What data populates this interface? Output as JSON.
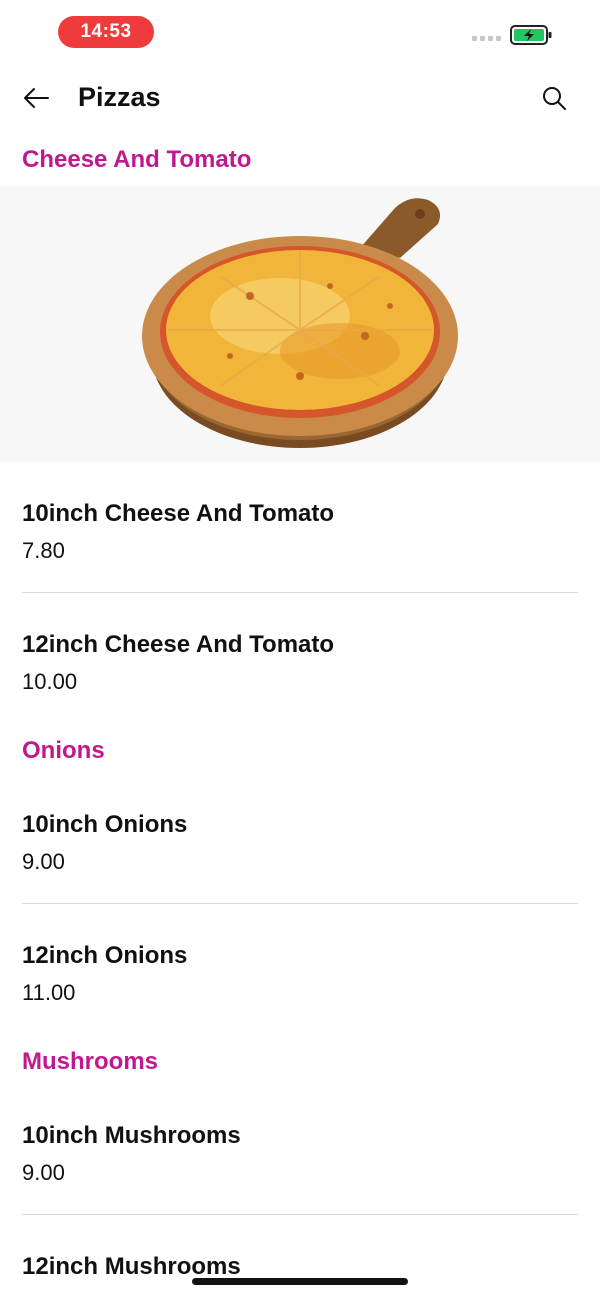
{
  "status_bar": {
    "time": "14:53",
    "battery_icon": "battery-charging-icon"
  },
  "header": {
    "title": "Pizzas",
    "back_icon": "arrow-left-icon",
    "search_icon": "search-icon"
  },
  "sections": [
    {
      "title": "Cheese And Tomato",
      "items": [
        {
          "name": "10inch Cheese And Tomato",
          "price": "7.80"
        },
        {
          "name": "12inch Cheese And Tomato",
          "price": "10.00"
        }
      ]
    },
    {
      "title": "Onions",
      "items": [
        {
          "name": "10inch Onions",
          "price": "9.00"
        },
        {
          "name": "12inch Onions",
          "price": "11.00"
        }
      ]
    },
    {
      "title": "Mushrooms",
      "items": [
        {
          "name": "10inch Mushrooms",
          "price": "9.00"
        },
        {
          "name": "12inch Mushrooms",
          "price": ""
        }
      ]
    }
  ],
  "colors": {
    "accent": "#c0188e",
    "time_pill": "#ee3b3b",
    "battery": "#22c55e"
  }
}
